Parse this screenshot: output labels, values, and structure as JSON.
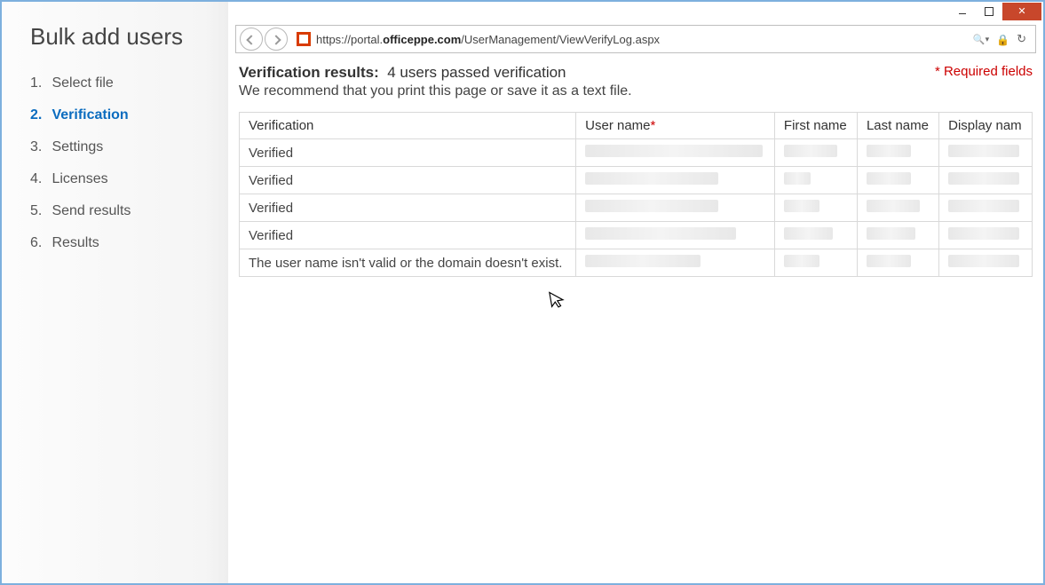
{
  "sidebar": {
    "title": "Bulk add users",
    "steps": [
      {
        "num": "1.",
        "label": "Select file"
      },
      {
        "num": "2.",
        "label": "Verification",
        "active": true
      },
      {
        "num": "3.",
        "label": "Settings"
      },
      {
        "num": "4.",
        "label": "Licenses"
      },
      {
        "num": "5.",
        "label": "Send results"
      },
      {
        "num": "6.",
        "label": "Results"
      }
    ]
  },
  "browser": {
    "url_prefix": "https://portal.",
    "url_bold": "officeppe.com",
    "url_suffix": "/UserManagement/ViewVerifyLog.aspx"
  },
  "header": {
    "label": "Verification results:",
    "summary": "4 users passed verification",
    "advice": "We recommend that you print this page or save it as a text file.",
    "required": "* Required fields"
  },
  "table": {
    "cols": [
      "Verification",
      "User name",
      "First name",
      "Last name",
      "Display nam"
    ],
    "required_col_index": 1,
    "rows": [
      {
        "verification": "Verified",
        "user_w": 200,
        "fn_w": 60,
        "ln_w": 50,
        "dn_w": 80
      },
      {
        "verification": "Verified",
        "user_w": 150,
        "fn_w": 30,
        "ln_w": 50,
        "dn_w": 80
      },
      {
        "verification": "Verified",
        "user_w": 150,
        "fn_w": 40,
        "ln_w": 60,
        "dn_w": 80
      },
      {
        "verification": "Verified",
        "user_w": 170,
        "fn_w": 55,
        "ln_w": 55,
        "dn_w": 80
      },
      {
        "verification": "The user name isn't valid or the domain doesn't exist.",
        "user_w": 130,
        "fn_w": 40,
        "ln_w": 50,
        "dn_w": 80
      }
    ]
  }
}
